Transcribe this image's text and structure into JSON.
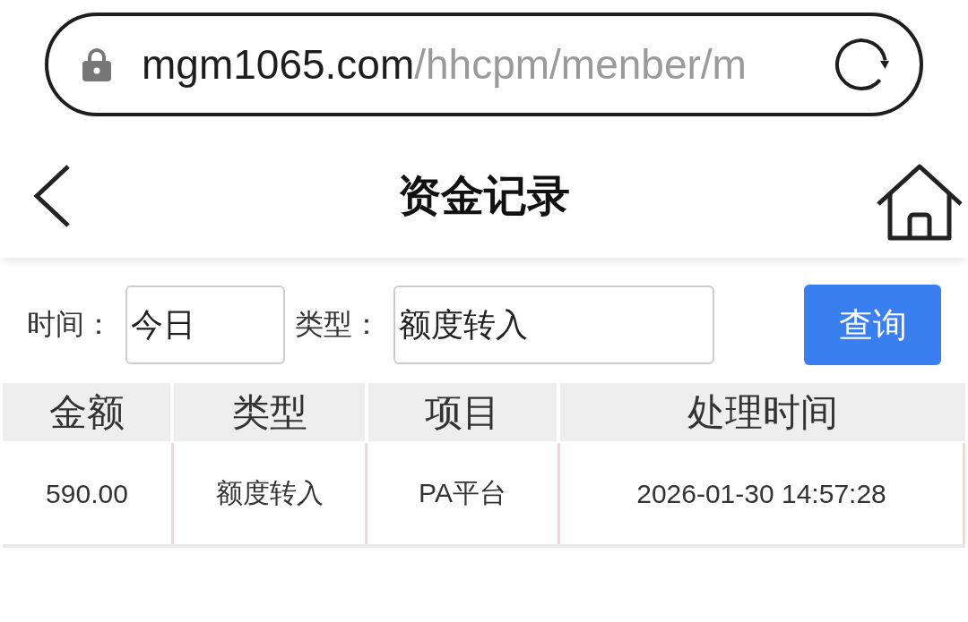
{
  "address_bar": {
    "domain": "mgm1065.com",
    "path": "/hhcpm/menber/m"
  },
  "header": {
    "title": "资金记录"
  },
  "filters": [
    {
      "label": "时间：",
      "value": "今日"
    },
    {
      "label": "类型：",
      "value": "额度转入"
    }
  ],
  "search_button": "查询",
  "table": {
    "columns": [
      "金额",
      "类型",
      "项目",
      "处理时间"
    ],
    "rows": [
      [
        "590.00",
        "额度转入",
        "PA平台",
        "2026-01-30 14:57:28"
      ]
    ]
  }
}
